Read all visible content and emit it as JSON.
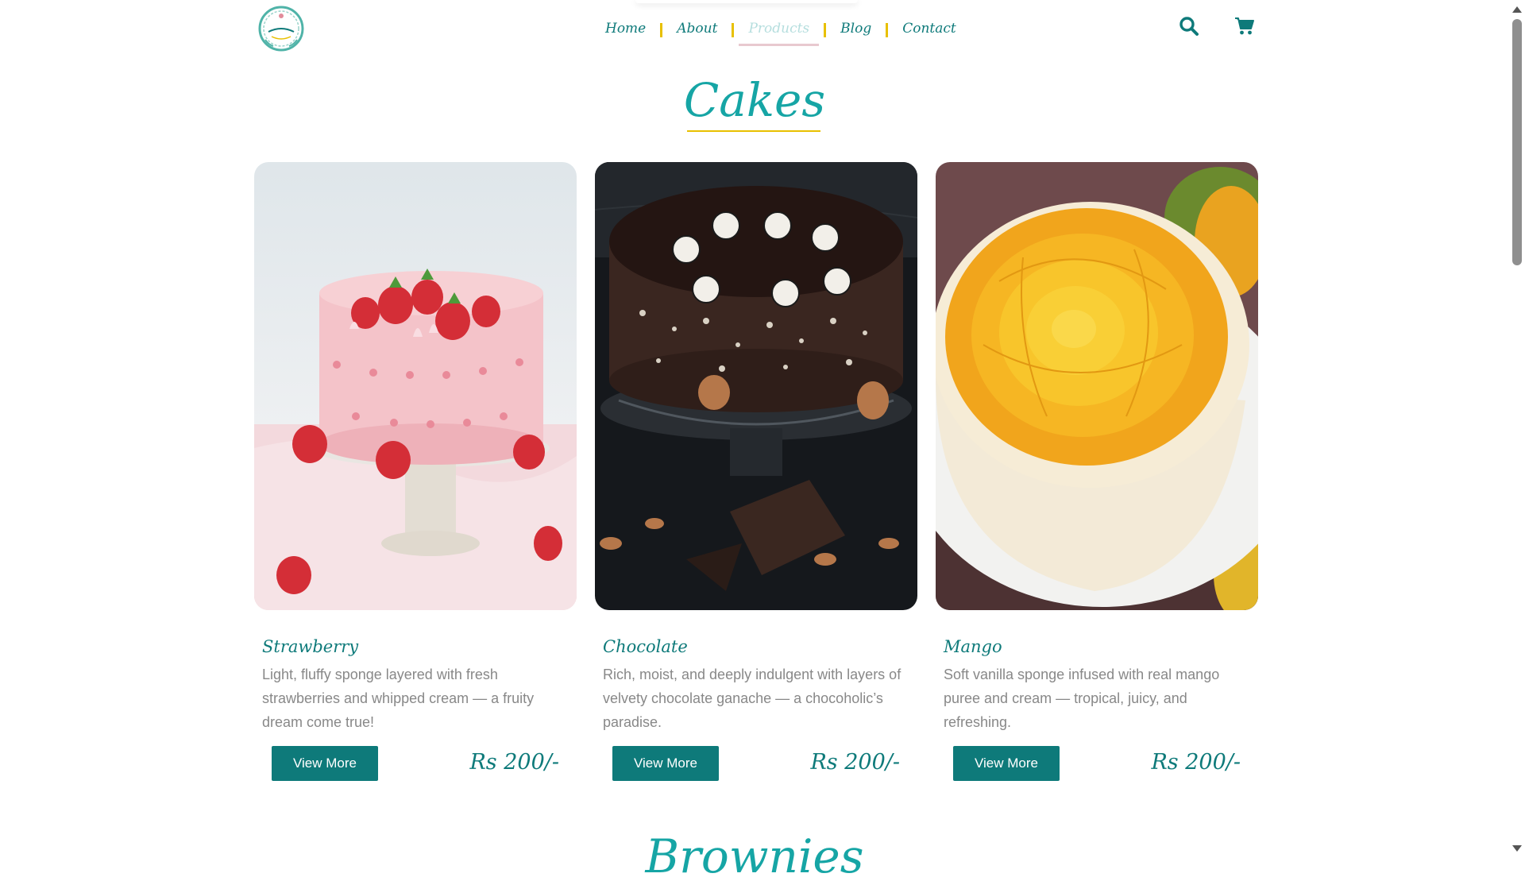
{
  "header": {
    "nav": [
      {
        "label": "Home",
        "active": false
      },
      {
        "label": "About",
        "active": false
      },
      {
        "label": "Products",
        "active": true
      },
      {
        "label": "Blog",
        "active": false
      },
      {
        "label": "Contact",
        "active": false
      }
    ],
    "icons": [
      "search-icon",
      "cart-icon"
    ]
  },
  "section": {
    "title": "Cakes"
  },
  "cards": [
    {
      "title": "Strawberry",
      "description": "Light, fluffy sponge layered with fresh strawberries and whipped cream — a fruity dream come true!",
      "button": "View More",
      "price": "Rs 200/-"
    },
    {
      "title": "Chocolate",
      "description": "Rich, moist, and deeply indulgent with layers of velvety chocolate ganache — a chocoholic’s paradise.",
      "button": "View More",
      "price": "Rs 200/-"
    },
    {
      "title": "Mango",
      "description": "Soft vanilla sponge infused with real mango puree and cream — tropical, juicy, and refreshing.",
      "button": "View More",
      "price": "Rs 200/-"
    }
  ],
  "next_section": {
    "title": "Brownies"
  },
  "colors": {
    "brand": "#0e7a7a",
    "title": "#16a5a5",
    "accent": "#e8c000",
    "muted_text": "#888888"
  }
}
